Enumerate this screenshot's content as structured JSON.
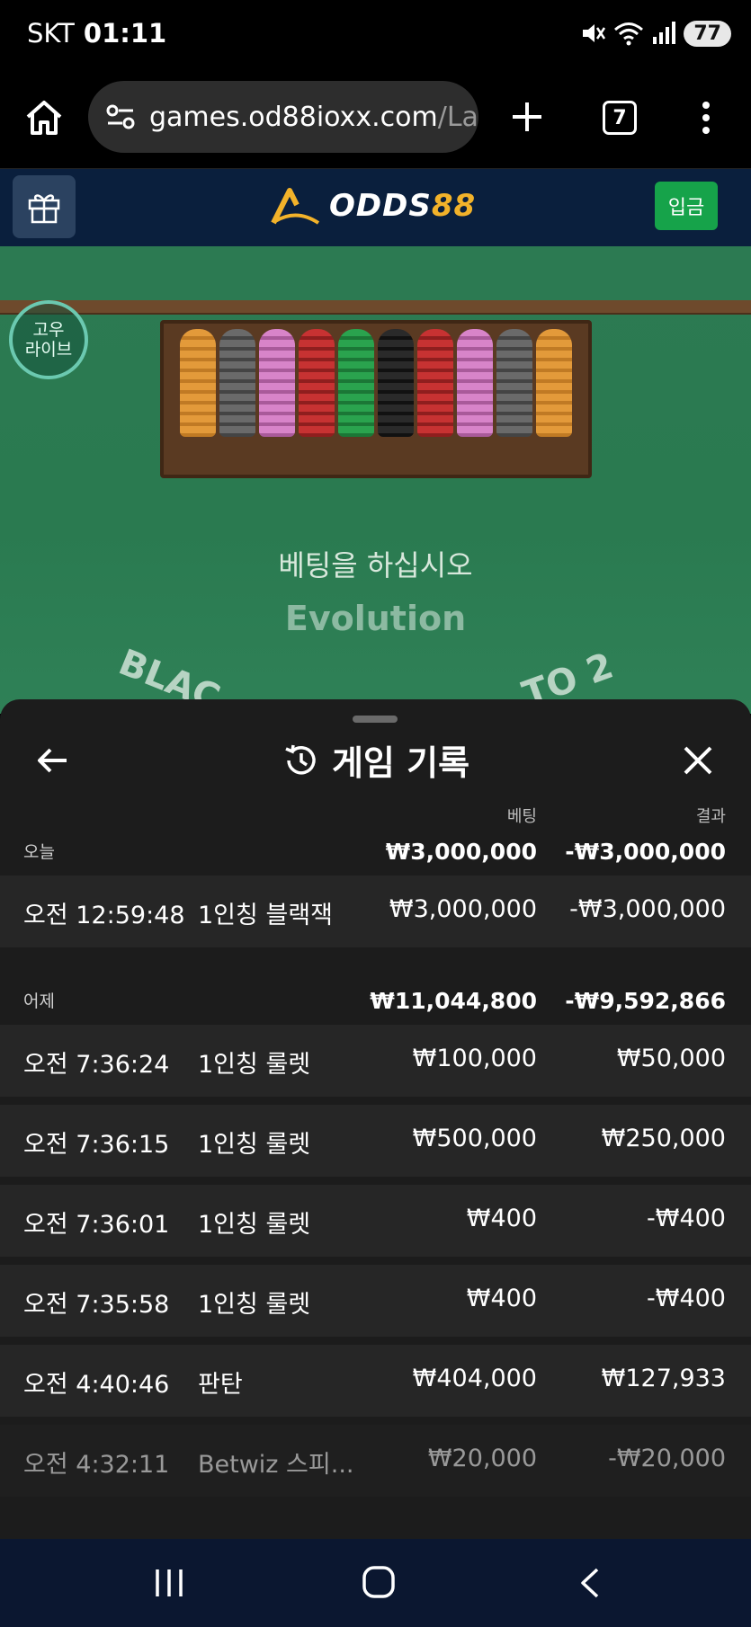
{
  "status_bar": {
    "carrier": "SKT",
    "time": "01:11",
    "battery": "77"
  },
  "browser": {
    "url_host": "games.od88ioxx.com",
    "url_path": "/Laun",
    "tab_count": "7"
  },
  "site_header": {
    "logo_part1": "ODDS",
    "logo_part2": "88",
    "deposit_label": "입금"
  },
  "game": {
    "live_badge_line1": "고우",
    "live_badge_line2": "라이브",
    "prompt": "베팅을 하십시오",
    "watermark": "Evolution",
    "arc_left": "BLAC",
    "arc_right": "TO 2"
  },
  "history": {
    "title": "게임 기록",
    "col_bet": "베팅",
    "col_result": "결과",
    "groups": [
      {
        "label": "오늘",
        "total_bet": "₩3,000,000",
        "total_result": "-₩3,000,000",
        "rows": [
          {
            "time": "오전 12:59:48",
            "game": "1인칭 블랙잭",
            "bet": "₩3,000,000",
            "result": "-₩3,000,000"
          }
        ]
      },
      {
        "label": "어제",
        "total_bet": "₩11,044,800",
        "total_result": "-₩9,592,866",
        "rows": [
          {
            "time": "오전 7:36:24",
            "game": "1인칭 룰렛",
            "bet": "₩100,000",
            "result": "₩50,000"
          },
          {
            "time": "오전 7:36:15",
            "game": "1인칭 룰렛",
            "bet": "₩500,000",
            "result": "₩250,000"
          },
          {
            "time": "오전 7:36:01",
            "game": "1인칭 룰렛",
            "bet": "₩400",
            "result": "-₩400"
          },
          {
            "time": "오전 7:35:58",
            "game": "1인칭 룰렛",
            "bet": "₩400",
            "result": "-₩400"
          },
          {
            "time": "오전 4:40:46",
            "game": "판탄",
            "bet": "₩404,000",
            "result": "₩127,933"
          },
          {
            "time": "오전 4:32:11",
            "game": "Betwiz 스피...",
            "bet": "₩20,000",
            "result": "-₩20,000"
          }
        ]
      }
    ]
  },
  "colors": {
    "site_header_bg": "#0a1f3d",
    "deposit_green": "#16a34a",
    "logo_gold": "#f2b22a",
    "table_green": "#2a7a50",
    "sheet_bg": "#1c1c1c"
  }
}
